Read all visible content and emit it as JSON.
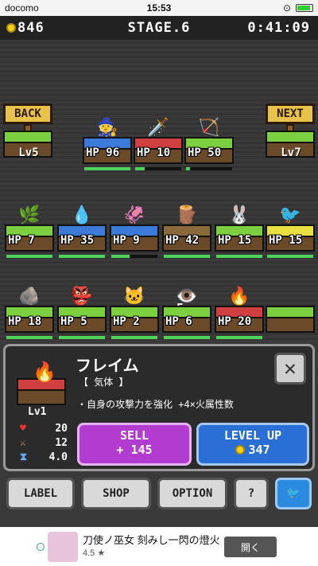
{
  "status": {
    "carrier": "docomo",
    "time": "15:53"
  },
  "hud": {
    "gold": "846",
    "stage": "STAGE.6",
    "timer": "0:41:09"
  },
  "nav": {
    "back": "BACK",
    "back_lv": "Lv5",
    "next": "NEXT",
    "next_lv": "Lv7"
  },
  "enemies": [
    {
      "hp": "HP 96",
      "fill": 1.0
    },
    {
      "hp": "HP 10",
      "fill": 0.2
    },
    {
      "hp": "HP 50",
      "fill": 0.08
    }
  ],
  "units_row1": [
    {
      "hp": "HP 7",
      "fill": 1.0
    },
    {
      "hp": "HP 35",
      "fill": 1.0
    },
    {
      "hp": "HP 9",
      "fill": 0.4
    },
    {
      "hp": "HP 42",
      "fill": 1.0
    },
    {
      "hp": "HP 15",
      "fill": 1.0
    },
    {
      "hp": "HP 15",
      "fill": 1.0
    }
  ],
  "wave_count": "5",
  "units_row2": [
    {
      "hp": "HP 18",
      "fill": 1.0
    },
    {
      "hp": "HP 5",
      "fill": 1.0
    },
    {
      "hp": "HP 2",
      "fill": 1.0
    },
    {
      "hp": "HP 6",
      "fill": 1.0
    },
    {
      "hp": "HP 20",
      "fill": 1.0
    }
  ],
  "panel": {
    "name": "フレイム",
    "attr": "【 気体 】",
    "desc": "・自身の攻撃力を強化 +4×火属性数",
    "level": "Lv1",
    "stats": {
      "hp": "20",
      "atk": "12",
      "speed": "4.0"
    },
    "sell_label": "SELL",
    "sell_value": "+ 145",
    "levelup_label": "LEVEL UP",
    "levelup_value": "347"
  },
  "buttons": {
    "label": "LABEL",
    "shop": "SHOP",
    "option": "OPTION",
    "help": "?"
  },
  "ad": {
    "title": "刀使ノ巫女 刻みし一閃の燈火",
    "rating": "4.5 ★",
    "open": "開く"
  },
  "colors": {
    "grass": "#7ccf3e",
    "sell": "#b23bd0",
    "levelup": "#2a6fd6",
    "hpbar": "#4ed25c"
  }
}
